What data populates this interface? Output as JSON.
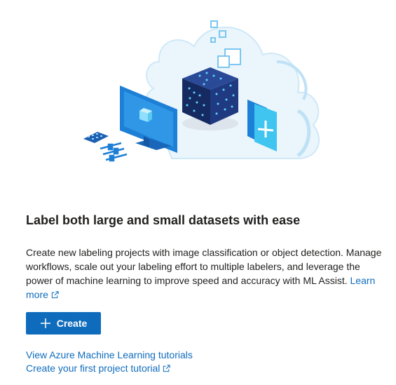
{
  "illustration": {
    "name": "data labeling illustration",
    "colors": {
      "cloud": "#eaf5fc",
      "primary_blue": "#1e7fd6",
      "dark_cube": "#1b2f6e",
      "accent_cyan": "#40c4f0"
    }
  },
  "heading": "Label both large and small datasets with ease",
  "description": {
    "text": "Create new labeling projects with image classification or object detection. Manage workflows, scale out your labeling effort to multiple labelers, and leverage the power of machine learning to improve speed and accuracy with ML Assist.",
    "learn_more": "Learn more"
  },
  "create_button": {
    "label": "Create",
    "icon": "plus-icon",
    "color": "#0f6cbd"
  },
  "links": {
    "tutorials": "View Azure Machine Learning tutorials",
    "first_project": "Create your first project tutorial"
  },
  "link_color": "#0f6cbd"
}
